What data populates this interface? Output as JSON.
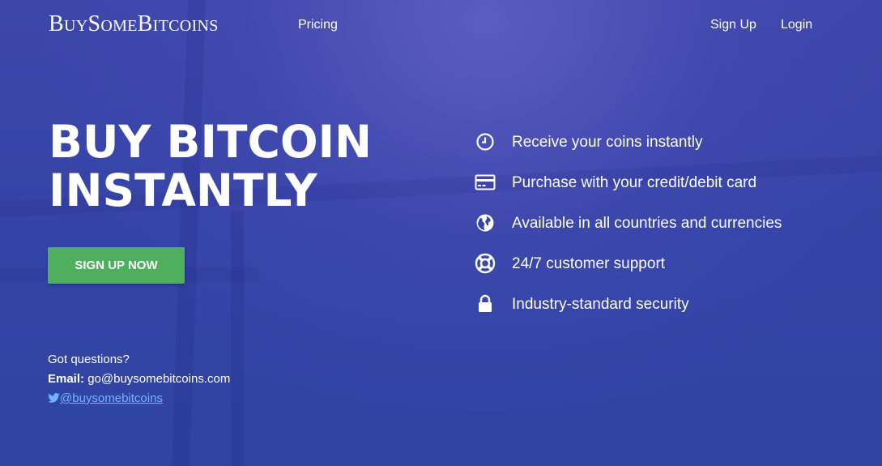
{
  "nav": {
    "logo": "BuySomeBitcoins",
    "pricing": "Pricing",
    "signup": "Sign Up",
    "login": "Login"
  },
  "hero": {
    "headline_line1": "BUY BITCOIN",
    "headline_line2": "INSTANTLY",
    "cta": "SIGN UP NOW"
  },
  "contact": {
    "question": "Got questions?",
    "email_label": "Email:",
    "email": "go@buysomebitcoins.com",
    "twitter": "@buysomebitcoins"
  },
  "features": [
    {
      "icon": "clock-icon",
      "text": "Receive your coins instantly"
    },
    {
      "icon": "credit-card-icon",
      "text": "Purchase with your credit/debit card"
    },
    {
      "icon": "globe-icon",
      "text": "Available in all countries and currencies"
    },
    {
      "icon": "lifebuoy-icon",
      "text": "24/7 customer support"
    },
    {
      "icon": "lock-icon",
      "text": "Industry-standard security"
    }
  ],
  "colors": {
    "background": "#3544a6",
    "cta": "#4eaf5f",
    "link": "#6fb6ff"
  }
}
